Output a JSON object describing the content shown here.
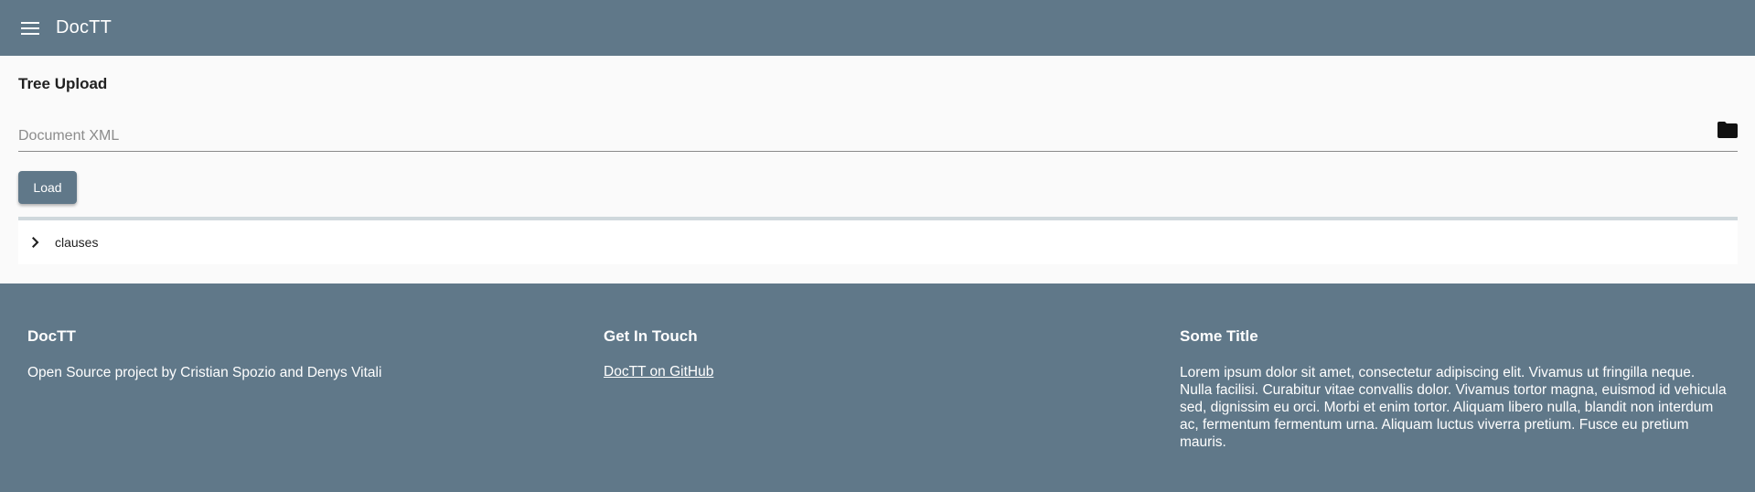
{
  "header": {
    "menu_icon": "menu-icon",
    "title": "DocTT"
  },
  "upload": {
    "title": "Tree Upload",
    "field_placeholder": "Document XML",
    "field_value": "",
    "folder_icon": "folder-icon",
    "load_label": "Load"
  },
  "tree": {
    "nodes": [
      {
        "label": "clauses",
        "icon": "chevron-right-icon"
      }
    ]
  },
  "footer": {
    "col1": {
      "title": "DocTT",
      "text": "Open Source project by Cristian Spozio and Denys Vitali"
    },
    "col2": {
      "title": "Get In Touch",
      "link": "DocTT on GitHub"
    },
    "col3": {
      "title": "Some Title",
      "text": "Lorem ipsum dolor sit amet, consectetur adipiscing elit. Vivamus ut fringilla neque. Nulla facilisi. Curabitur vitae convallis dolor. Vivamus tortor magna, euismod id vehicula sed, dignissim eu orci. Morbi et enim tortor. Aliquam libero nulla, blandit non interdum ac, fermentum fermentum urna. Aliquam luctus viverra pretium. Fusce eu pretium mauris."
    }
  },
  "colors": {
    "primary": "#607889",
    "background": "#fafafa",
    "divider": "#cfd8dc"
  }
}
